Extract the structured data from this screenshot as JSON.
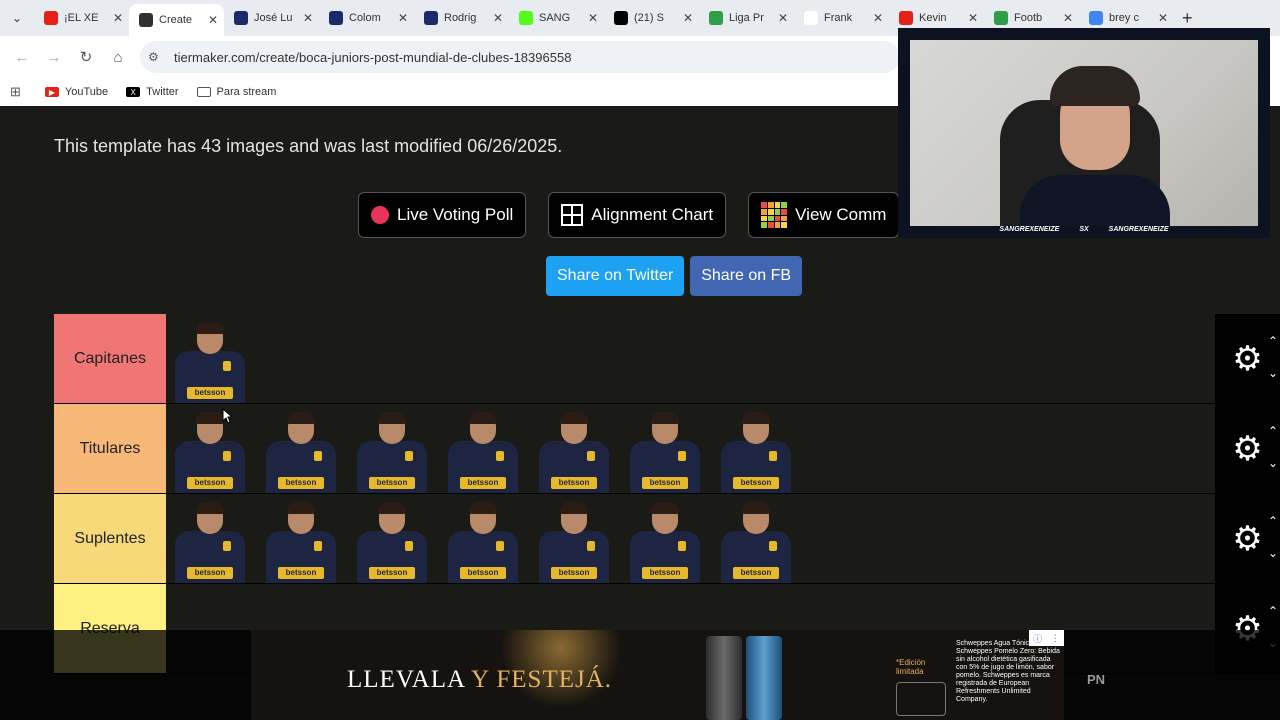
{
  "tabs": [
    {
      "title": "¡EL XE",
      "favicon": "youtube-icon",
      "color": "#e62117"
    },
    {
      "title": "Create",
      "favicon": "tiermaker-icon",
      "color": "#2f2f2f",
      "active": true
    },
    {
      "title": "José Lu",
      "favicon": "news-icon",
      "color": "#1b2a6b"
    },
    {
      "title": "Colom",
      "favicon": "news-icon",
      "color": "#1b2a6b"
    },
    {
      "title": "Rodrig",
      "favicon": "news-icon",
      "color": "#1b2a6b"
    },
    {
      "title": "SANG",
      "favicon": "kick-icon",
      "color": "#53fc18"
    },
    {
      "title": "(21) S",
      "favicon": "x-icon",
      "color": "#000000"
    },
    {
      "title": "Liga Pr",
      "favicon": "soccer-icon",
      "color": "#2e9e48"
    },
    {
      "title": "Frank",
      "favicon": "wikipedia-icon",
      "color": "#ffffff"
    },
    {
      "title": "Kevin",
      "favicon": "youtube-icon",
      "color": "#e62117"
    },
    {
      "title": "Footb",
      "favicon": "soccer-icon",
      "color": "#2e9e48"
    },
    {
      "title": "brey c",
      "favicon": "google-icon",
      "color": "#4285f4"
    }
  ],
  "toolbar": {
    "url": "tiermaker.com/create/boca-juniors-post-mundial-de-clubes-18396558"
  },
  "bookmarks": [
    {
      "label": "YouTube",
      "icon": "youtube-icon",
      "color": "#e62117"
    },
    {
      "label": "Twitter",
      "icon": "x-icon",
      "color": "#000000"
    },
    {
      "label": "Para stream",
      "icon": "folder-icon",
      "color": "#555555"
    }
  ],
  "page": {
    "info_text": "This template has 43 images and was last modified 06/26/2025.",
    "buttons": {
      "live_voting": "Live Voting Poll",
      "alignment_chart": "Alignment Chart",
      "view_community": "View Comm"
    },
    "share": {
      "twitter": "Share on Twitter",
      "fb": "Share on FB",
      "twitter_color": "#1da1f2",
      "fb_color": "#4267b2"
    }
  },
  "tiers": [
    {
      "label": "Capitanes",
      "color": "#f07676",
      "players": 1
    },
    {
      "label": "Titulares",
      "color": "#f7b878",
      "players": 7
    },
    {
      "label": "Suplentes",
      "color": "#f8d97a",
      "players": 7
    },
    {
      "label": "Reserva",
      "color": "#fbf080",
      "players": 0
    }
  ],
  "player_sponsor": "betsson",
  "webcam": {
    "caption_left": "SANGREXENEIZE",
    "caption_mid": "SX",
    "caption_right": "SANGREXENEIZE"
  },
  "ad": {
    "slogan_white": "LLEVALA",
    "slogan_gold": "Y FESTEJÁ.",
    "edicion": "*Edición limitada",
    "legal": "Schweppes Agua Tónica, Schweppes Pomelo Zero: Bebida sin alcohol dietética gasificada con 5% de jugo de limón, sabor pomelo. Schweppes es marca registrada de European Refreshments Unlimited Company.",
    "right_text": "PN"
  }
}
